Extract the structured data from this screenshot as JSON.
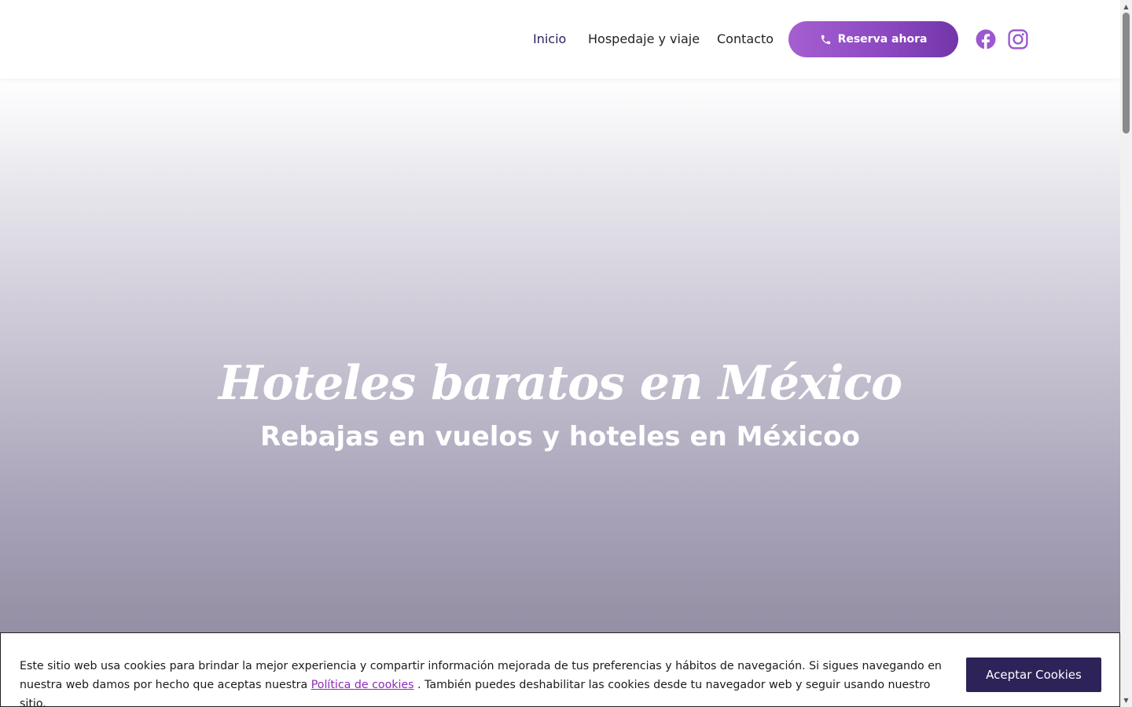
{
  "header": {
    "nav": [
      {
        "label": "Inicio",
        "active": true
      },
      {
        "label": "Hospedaje y viaje",
        "active": false
      },
      {
        "label": "Contacto",
        "active": false
      }
    ],
    "cta_label": "Reserva ahora",
    "cta_icon": "phone-icon",
    "social_icons": [
      "facebook-icon",
      "instagram-icon"
    ],
    "accent_color": "#9b59cf"
  },
  "hero": {
    "title": "Hoteles baratos en México",
    "subtitle": "Rebajas en vuelos y hoteles en Méxicoo"
  },
  "cookie_banner": {
    "text_before": "Este sitio web usa cookies para brindar la mejor experiencia y compartir información mejorada de tus preferencias y hábitos de navegación. Si sigues navegando en nuestra web damos por hecho que aceptas nuestra ",
    "link_label": "Política de cookies",
    "text_after": " . También puedes deshabilitar las cookies desde tu navegador web y seguir usando nuestro sitio.",
    "accept_label": "Aceptar Cookies",
    "button_color": "#2d2359"
  }
}
